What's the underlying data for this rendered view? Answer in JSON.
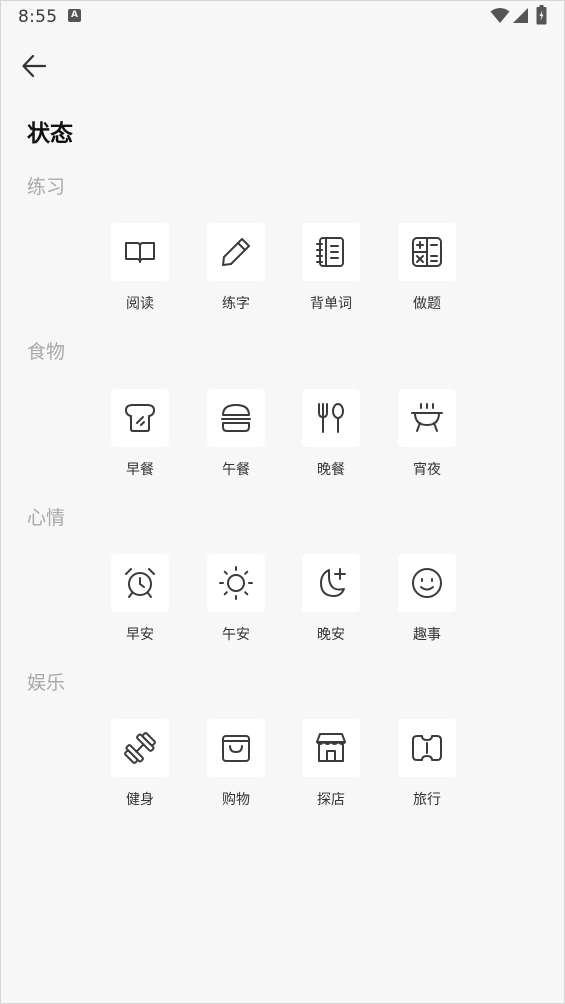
{
  "status_bar": {
    "time": "8:55",
    "notif_badge": "A"
  },
  "header": {
    "title": "状态"
  },
  "sections": [
    {
      "title": "练习",
      "items": [
        {
          "label": "阅读",
          "icon": "book-icon"
        },
        {
          "label": "练字",
          "icon": "pencil-icon"
        },
        {
          "label": "背单词",
          "icon": "notebook-icon"
        },
        {
          "label": "做题",
          "icon": "calculator-icon"
        }
      ]
    },
    {
      "title": "食物",
      "items": [
        {
          "label": "早餐",
          "icon": "toast-icon"
        },
        {
          "label": "午餐",
          "icon": "burger-icon"
        },
        {
          "label": "晚餐",
          "icon": "fork-spoon-icon"
        },
        {
          "label": "宵夜",
          "icon": "grill-icon"
        }
      ]
    },
    {
      "title": "心情",
      "items": [
        {
          "label": "早安",
          "icon": "alarm-clock-icon"
        },
        {
          "label": "午安",
          "icon": "sun-icon"
        },
        {
          "label": "晚安",
          "icon": "moon-icon"
        },
        {
          "label": "趣事",
          "icon": "smiley-icon"
        }
      ]
    },
    {
      "title": "娱乐",
      "items": [
        {
          "label": "健身",
          "icon": "dumbbell-icon"
        },
        {
          "label": "购物",
          "icon": "shopping-bag-icon"
        },
        {
          "label": "探店",
          "icon": "storefront-icon"
        },
        {
          "label": "旅行",
          "icon": "ticket-icon"
        }
      ]
    }
  ]
}
